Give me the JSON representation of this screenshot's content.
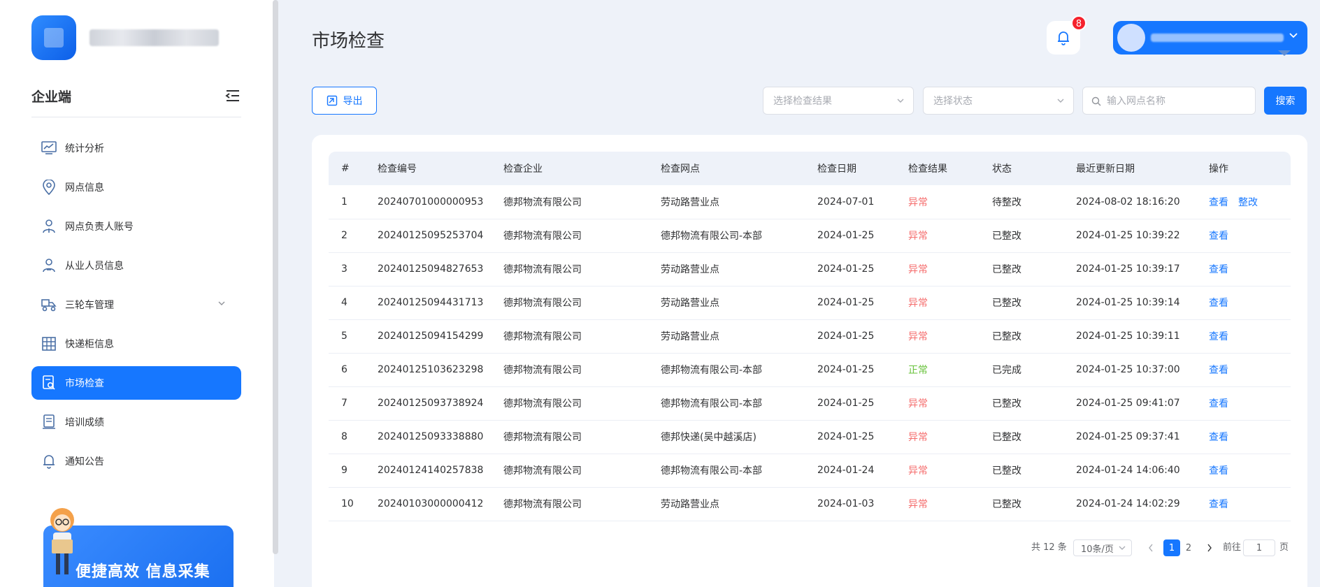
{
  "sidebar": {
    "section_title": "企业端",
    "items": [
      {
        "label": "统计分析",
        "icon": "chart-icon",
        "active": false
      },
      {
        "label": "网点信息",
        "icon": "location-icon",
        "active": false
      },
      {
        "label": "网点负责人账号",
        "icon": "user-badge-icon",
        "active": false
      },
      {
        "label": "从业人员信息",
        "icon": "user-badge-icon",
        "active": false
      },
      {
        "label": "三轮车管理",
        "icon": "tricycle-icon",
        "active": false,
        "has_submenu": true
      },
      {
        "label": "快递柜信息",
        "icon": "locker-icon",
        "active": false
      },
      {
        "label": "市场检查",
        "icon": "inspection-icon",
        "active": true
      },
      {
        "label": "培训成绩",
        "icon": "score-icon",
        "active": false
      },
      {
        "label": "通知公告",
        "icon": "bell-icon",
        "active": false
      }
    ],
    "promo_text": "便捷高效 信息采集"
  },
  "header": {
    "page_title": "市场检查",
    "notification_count": "8"
  },
  "toolbar": {
    "export_label": "导出",
    "result_select_placeholder": "选择检查结果",
    "status_select_placeholder": "选择状态",
    "search_placeholder": "输入网点名称",
    "search_button": "搜索"
  },
  "table": {
    "columns": [
      "#",
      "检查编号",
      "检查企业",
      "检查网点",
      "检查日期",
      "检查结果",
      "状态",
      "最近更新日期",
      "操作"
    ],
    "rows": [
      {
        "idx": "1",
        "code": "20240701000000953",
        "company": "德邦物流有限公司",
        "site": "劳动路营业点",
        "date": "2024-07-01",
        "result": "异常",
        "status": "待整改",
        "updated": "2024-08-02 18:16:20",
        "actions": [
          "查看",
          "整改"
        ]
      },
      {
        "idx": "2",
        "code": "20240125095253704",
        "company": "德邦物流有限公司",
        "site": "德邦物流有限公司-本部",
        "date": "2024-01-25",
        "result": "异常",
        "status": "已整改",
        "updated": "2024-01-25 10:39:22",
        "actions": [
          "查看"
        ]
      },
      {
        "idx": "3",
        "code": "20240125094827653",
        "company": "德邦物流有限公司",
        "site": "劳动路营业点",
        "date": "2024-01-25",
        "result": "异常",
        "status": "已整改",
        "updated": "2024-01-25 10:39:17",
        "actions": [
          "查看"
        ]
      },
      {
        "idx": "4",
        "code": "20240125094431713",
        "company": "德邦物流有限公司",
        "site": "劳动路营业点",
        "date": "2024-01-25",
        "result": "异常",
        "status": "已整改",
        "updated": "2024-01-25 10:39:14",
        "actions": [
          "查看"
        ]
      },
      {
        "idx": "5",
        "code": "20240125094154299",
        "company": "德邦物流有限公司",
        "site": "劳动路营业点",
        "date": "2024-01-25",
        "result": "异常",
        "status": "已整改",
        "updated": "2024-01-25 10:39:11",
        "actions": [
          "查看"
        ]
      },
      {
        "idx": "6",
        "code": "20240125103623298",
        "company": "德邦物流有限公司",
        "site": "德邦物流有限公司-本部",
        "date": "2024-01-25",
        "result": "正常",
        "status": "已完成",
        "updated": "2024-01-25 10:37:00",
        "actions": [
          "查看"
        ]
      },
      {
        "idx": "7",
        "code": "20240125093738924",
        "company": "德邦物流有限公司",
        "site": "德邦物流有限公司-本部",
        "date": "2024-01-25",
        "result": "异常",
        "status": "已整改",
        "updated": "2024-01-25 09:41:07",
        "actions": [
          "查看"
        ]
      },
      {
        "idx": "8",
        "code": "20240125093338880",
        "company": "德邦物流有限公司",
        "site": "德邦快递(吴中越溪店)",
        "date": "2024-01-25",
        "result": "异常",
        "status": "已整改",
        "updated": "2024-01-25 09:37:41",
        "actions": [
          "查看"
        ]
      },
      {
        "idx": "9",
        "code": "20240124140257838",
        "company": "德邦物流有限公司",
        "site": "德邦物流有限公司-本部",
        "date": "2024-01-24",
        "result": "异常",
        "status": "已整改",
        "updated": "2024-01-24 14:06:40",
        "actions": [
          "查看"
        ]
      },
      {
        "idx": "10",
        "code": "20240103000000412",
        "company": "德邦物流有限公司",
        "site": "劳动路营业点",
        "date": "2024-01-03",
        "result": "异常",
        "status": "已整改",
        "updated": "2024-01-24 14:02:29",
        "actions": [
          "查看"
        ]
      }
    ]
  },
  "pagination": {
    "total_text": "共 12 条",
    "page_size": "10条/页",
    "pages": [
      "1",
      "2"
    ],
    "current_page": "1",
    "goto_prefix": "前往",
    "goto_value": "1",
    "goto_suffix": "页"
  },
  "colors": {
    "primary": "#1677ff",
    "abnormal": "#f56c6c",
    "normal": "#67c23a",
    "background": "#eef2f9"
  }
}
